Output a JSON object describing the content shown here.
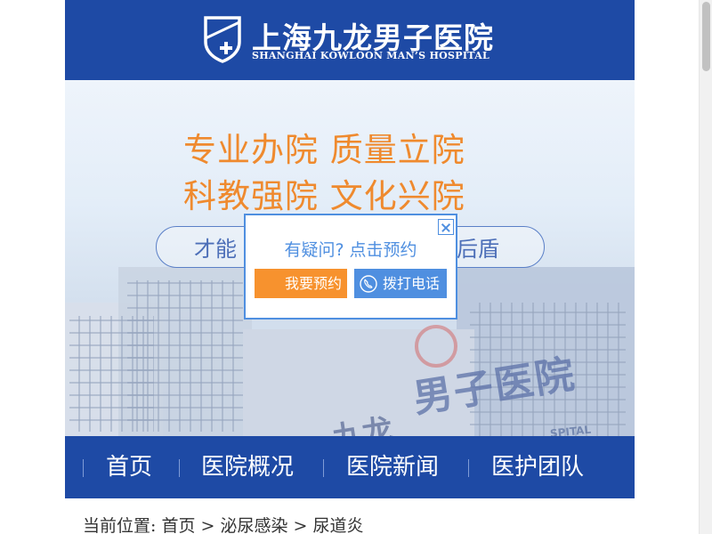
{
  "header": {
    "logo_cn": "上海九龙男子医院",
    "logo_en": "SHANGHAI KOWLOON MAN’S HOSPITAL",
    "logo_icon": "shield-cross-icon"
  },
  "banner": {
    "slogan_line1": "专业办院  质量立院",
    "slogan_line2": "科教强院  文化兴院",
    "pill_left": "才能",
    "pill_right": "后盾"
  },
  "nav": {
    "items": [
      "首页",
      "医院概况",
      "医院新闻",
      "医护团队"
    ]
  },
  "breadcrumb": {
    "prefix": "当前位置:",
    "home": "首页",
    "sep": ">",
    "category": "泌尿感染",
    "current": "尿道炎"
  },
  "popup": {
    "title": "有疑问? 点击预约",
    "book_label": "我要预约",
    "call_label": "拨打电话",
    "call_icon": "phone-icon",
    "close_icon": "close-icon"
  },
  "colors": {
    "brand_blue": "#1e4aa5",
    "accent_orange": "#ef8a2e",
    "popup_blue": "#4f8fe0",
    "button_orange": "#f7922e"
  }
}
